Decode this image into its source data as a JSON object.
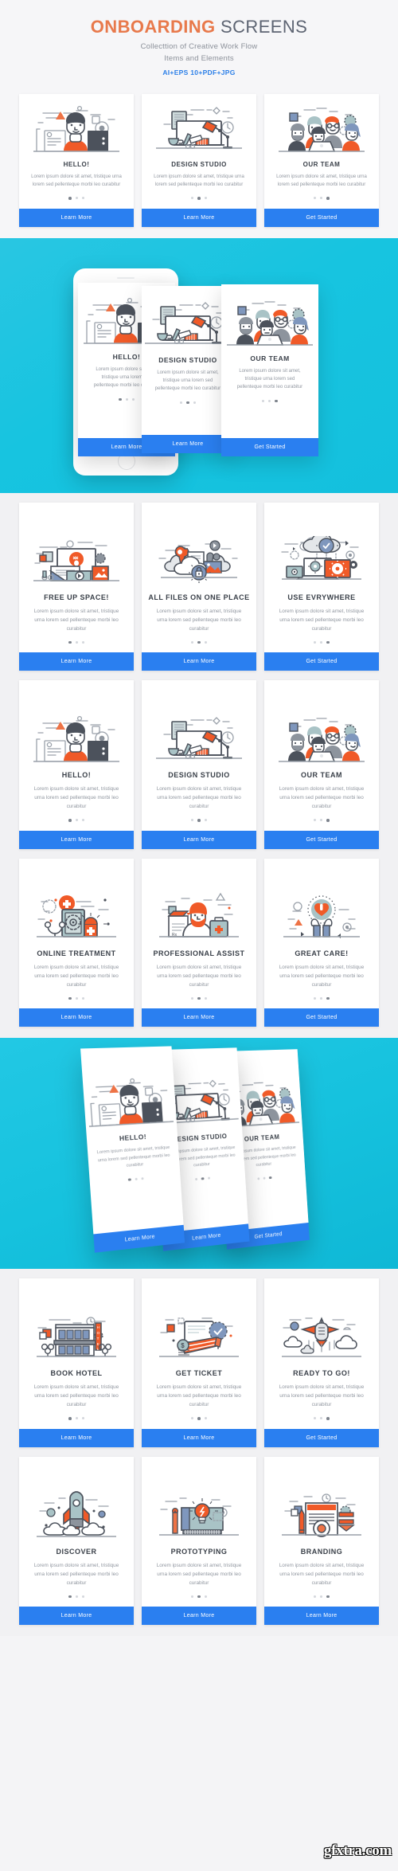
{
  "header": {
    "title_bold": "ONBOARDING",
    "title_light": " SCREENS",
    "subtitle_line1": "Collecttion of Creative Work Flow",
    "subtitle_line2": "Items and Elements",
    "formats": "AI+EPS 10+PDF+JPG"
  },
  "common": {
    "body_text": "Lorem ipsum dolore sit amet, tristique urna lorem sed pellenteque morbi leo curabitur",
    "learn_more": "Learn More",
    "get_started": "Get Started"
  },
  "colors": {
    "accent_orange": "#e8794b",
    "title_gray": "#5d6472",
    "button_blue": "#2a7ff0",
    "format_blue": "#2b7fe8",
    "hero_cyan": "#17c4e0",
    "page_bg": "#f1f1f3",
    "card_bg": "#ffffff"
  },
  "preview_row": {
    "cards": [
      {
        "title": "HELLO!",
        "button": "Learn More",
        "active_dot": 0,
        "art": "person-workspace"
      },
      {
        "title": "DESIGN STUDIO",
        "button": "Learn More",
        "active_dot": 1,
        "art": "desk-lamp-monitor"
      },
      {
        "title": "OUR TEAM",
        "button": "Get Started",
        "active_dot": 2,
        "art": "team-laptop"
      }
    ]
  },
  "hero_phone": {
    "cards": [
      {
        "title": "HELLO!",
        "button": "Learn More",
        "active_dot": 0,
        "art": "person-workspace"
      },
      {
        "title": "DESIGN STUDIO",
        "button": "Learn More",
        "active_dot": 1,
        "art": "desk-lamp-monitor"
      },
      {
        "title": "OUR TEAM",
        "button": "Get Started",
        "active_dot": 2,
        "art": "team-laptop"
      }
    ]
  },
  "grid_rows": [
    {
      "cards": [
        {
          "title": "FREE UP SPACE!",
          "button": "Learn More",
          "active_dot": 0,
          "art": "monitor-media"
        },
        {
          "title": "ALL FILES ON ONE PLACE",
          "button": "Learn More",
          "active_dot": 1,
          "art": "cloud-lock"
        },
        {
          "title": "USE EVRYWHERE",
          "button": "Get Started",
          "active_dot": 2,
          "art": "devices-sync"
        }
      ]
    },
    {
      "cards": [
        {
          "title": "HELLO!",
          "button": "Learn More",
          "active_dot": 0,
          "art": "person-workspace"
        },
        {
          "title": "DESIGN STUDIO",
          "button": "Learn More",
          "active_dot": 1,
          "art": "desk-lamp-monitor"
        },
        {
          "title": "OUR TEAM",
          "button": "Get Started",
          "active_dot": 2,
          "art": "team-laptop"
        }
      ]
    },
    {
      "cards": [
        {
          "title": "ONLINE TREATMENT",
          "button": "Learn More",
          "active_dot": 0,
          "art": "phone-medical"
        },
        {
          "title": "PROFESSIONAL ASSIST",
          "button": "Learn More",
          "active_dot": 1,
          "art": "doctor-kit"
        },
        {
          "title": "GREAT CARE!",
          "button": "Get Started",
          "active_dot": 2,
          "art": "hands-heart"
        }
      ]
    }
  ],
  "hero_tilt": {
    "cards": [
      {
        "title": "HELLO!",
        "button": "Learn More",
        "active_dot": 0,
        "art": "person-workspace"
      },
      {
        "title": "DESIGN STUDIO",
        "button": "Learn More",
        "active_dot": 1,
        "art": "desk-lamp-monitor"
      },
      {
        "title": "OUR TEAM",
        "button": "Get Started",
        "active_dot": 2,
        "art": "team-laptop"
      }
    ]
  },
  "grid_rows_bottom": [
    {
      "cards": [
        {
          "title": "BOOK HOTEL",
          "button": "Learn More",
          "active_dot": 0,
          "art": "hotel-building"
        },
        {
          "title": "GET TICKET",
          "button": "Learn More",
          "active_dot": 1,
          "art": "ticket-badge"
        },
        {
          "title": "READY TO GO!",
          "button": "Get Started",
          "active_dot": 2,
          "art": "airplane-clouds"
        }
      ]
    },
    {
      "cards": [
        {
          "title": "DISCOVER",
          "button": "Learn More",
          "active_dot": 0,
          "art": "rocket-launch"
        },
        {
          "title": "PROTOTYPING",
          "button": "Learn More",
          "active_dot": 1,
          "art": "lightbulb-board"
        },
        {
          "title": "BRANDING",
          "button": "Learn More",
          "active_dot": 2,
          "art": "document-stamp"
        }
      ]
    }
  ],
  "watermark": {
    "text": "gfxtra.com"
  }
}
